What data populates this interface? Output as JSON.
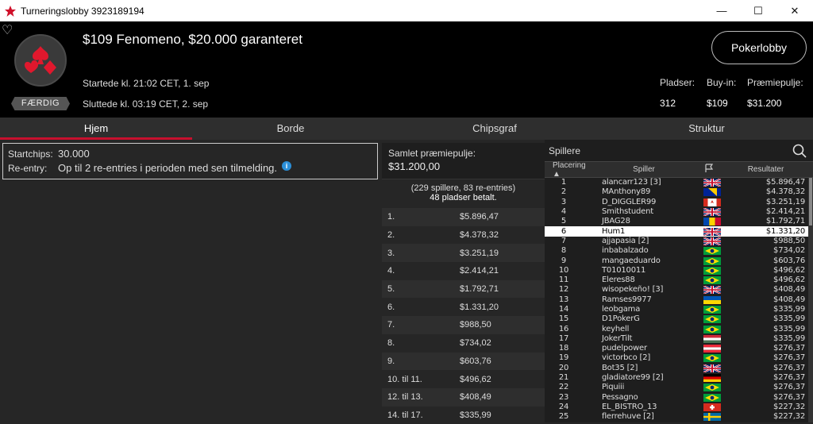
{
  "window": {
    "title": "Turneringslobby 3923189194",
    "min": "—",
    "max": "☐",
    "close": "✕"
  },
  "header": {
    "tournament_name": "$109 Fenomeno, $20.000 garanteret",
    "status_badge": "FÆRDIG",
    "started": "Startede kl. 21:02 CET, 1. sep",
    "ended": "Sluttede kl. 03:19 CET, 2. sep",
    "pokerlobby_button": "Pokerlobby",
    "stats": [
      {
        "label": "Pladser:",
        "value": "312"
      },
      {
        "label": "Buy-in:",
        "value": "$109"
      },
      {
        "label": "Præmiepulje:",
        "value": "$31.200"
      }
    ]
  },
  "tabs": [
    "Hjem",
    "Borde",
    "Chipsgraf",
    "Struktur"
  ],
  "info": {
    "startchips_label": "Startchips:",
    "startchips_value": "30.000",
    "reentry_label": "Re-entry:",
    "reentry_value": "Op til 2 re-entries i perioden med sen tilmelding."
  },
  "prize": {
    "title": "Samlet præmiepulje:",
    "amount": "$31.200,00",
    "players_note": "(229 spillere, 83 re-entries)",
    "paid_note": "48 pladser betalt.",
    "rows": [
      {
        "place": "1.",
        "amount": "$5.896,47"
      },
      {
        "place": "2.",
        "amount": "$4.378,32"
      },
      {
        "place": "3.",
        "amount": "$3.251,19"
      },
      {
        "place": "4.",
        "amount": "$2.414,21"
      },
      {
        "place": "5.",
        "amount": "$1.792,71"
      },
      {
        "place": "6.",
        "amount": "$1.331,20"
      },
      {
        "place": "7.",
        "amount": "$988,50"
      },
      {
        "place": "8.",
        "amount": "$734,02"
      },
      {
        "place": "9.",
        "amount": "$603,76"
      },
      {
        "place": "10. til 11.",
        "amount": "$496,62"
      },
      {
        "place": "12. til 13.",
        "amount": "$408,49"
      },
      {
        "place": "14. til 17.",
        "amount": "$335,99"
      }
    ]
  },
  "players": {
    "title": "Spillere",
    "columns": {
      "place": "Placering",
      "player": "Spiller",
      "result": "Resultater"
    },
    "rows": [
      {
        "n": "1",
        "name": "alancarr123 [3]",
        "flag": "uk",
        "result": "$5.896,47"
      },
      {
        "n": "2",
        "name": "MAnthony89",
        "flag": "ba",
        "result": "$4.378,32"
      },
      {
        "n": "3",
        "name": "D_DIGGLER99",
        "flag": "ca",
        "result": "$3.251,19"
      },
      {
        "n": "4",
        "name": "Smithstudent",
        "flag": "uk",
        "result": "$2.414,21"
      },
      {
        "n": "5",
        "name": "JBAG28",
        "flag": "md",
        "result": "$1.792,71"
      },
      {
        "n": "6",
        "name": "Hum1",
        "flag": "uk",
        "result": "$1.331,20"
      },
      {
        "n": "7",
        "name": "ajjapasia [2]",
        "flag": "uk",
        "result": "$988,50"
      },
      {
        "n": "8",
        "name": "inbabalzado",
        "flag": "br",
        "result": "$734,02"
      },
      {
        "n": "9",
        "name": "mangaeduardo",
        "flag": "br",
        "result": "$603,76"
      },
      {
        "n": "10",
        "name": "T01010011",
        "flag": "br",
        "result": "$496,62"
      },
      {
        "n": "11",
        "name": "Eleres88",
        "flag": "br",
        "result": "$496,62"
      },
      {
        "n": "12",
        "name": "wisopekeño! [3]",
        "flag": "uk",
        "result": "$408,49"
      },
      {
        "n": "13",
        "name": "Ramses9977",
        "flag": "ua",
        "result": "$408,49"
      },
      {
        "n": "14",
        "name": "leobgama",
        "flag": "br",
        "result": "$335,99"
      },
      {
        "n": "15",
        "name": "D1PokerG",
        "flag": "br",
        "result": "$335,99"
      },
      {
        "n": "16",
        "name": "keyhell",
        "flag": "br",
        "result": "$335,99"
      },
      {
        "n": "17",
        "name": "JokerTilt",
        "flag": "hu",
        "result": "$335,99"
      },
      {
        "n": "18",
        "name": "pudelpower",
        "flag": "at",
        "result": "$276,37"
      },
      {
        "n": "19",
        "name": "victorbco [2]",
        "flag": "br",
        "result": "$276,37"
      },
      {
        "n": "20",
        "name": "Bot35 [2]",
        "flag": "uk",
        "result": "$276,37"
      },
      {
        "n": "21",
        "name": "gladiatore99 [2]",
        "flag": "de",
        "result": "$276,37"
      },
      {
        "n": "22",
        "name": "Piquiii",
        "flag": "br",
        "result": "$276,37"
      },
      {
        "n": "23",
        "name": "Pessagno",
        "flag": "br",
        "result": "$276,37"
      },
      {
        "n": "24",
        "name": "EL_BISTRO_13",
        "flag": "ch",
        "result": "$227,32"
      },
      {
        "n": "25",
        "name": "flerrehuve [2]",
        "flag": "se",
        "result": "$227,32"
      }
    ],
    "highlighted_row": "6"
  }
}
